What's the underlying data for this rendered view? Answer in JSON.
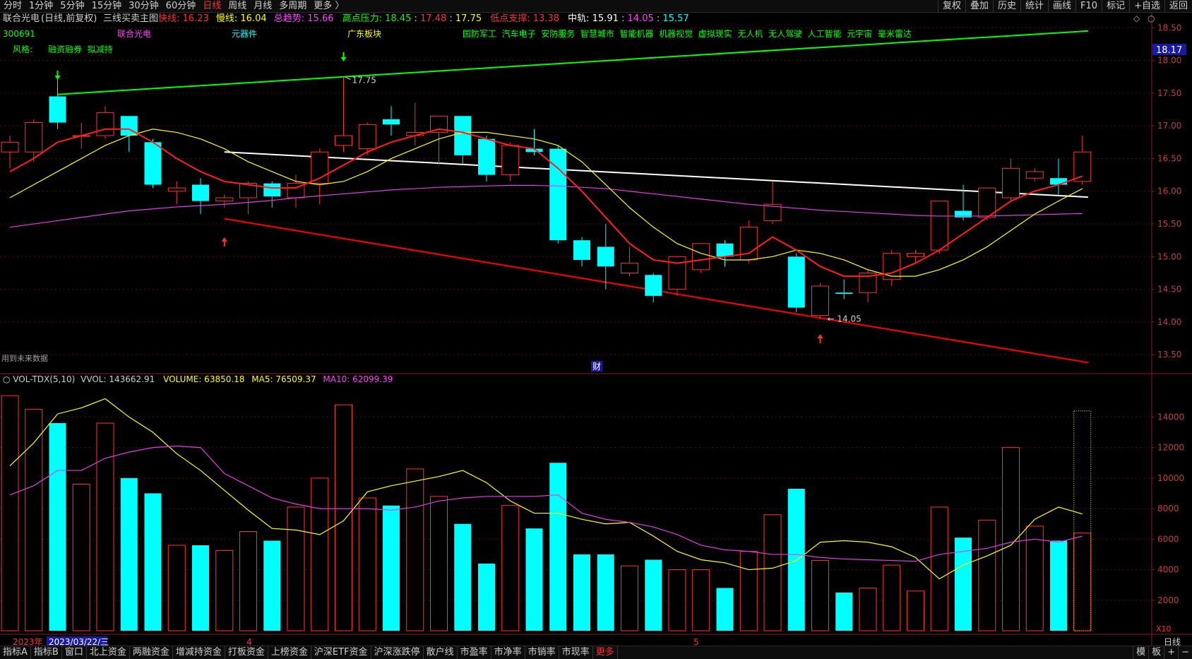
{
  "toolbar": {
    "left": [
      "分时",
      "1分钟",
      "5分钟",
      "15分钟",
      "30分钟",
      "60分钟",
      "日线",
      "周线",
      "月线",
      "多周期",
      "更多 〉"
    ],
    "active": "日线",
    "right": [
      "复权",
      "叠加",
      "历史",
      "统计",
      "画线",
      "F10",
      "标记",
      "+自选",
      "返回"
    ]
  },
  "header": {
    "stock": "联合光电",
    "mode": "(日线,前复权)",
    "indicator": "三线买卖主图",
    "items": [
      {
        "label": "快线: ",
        "value": "16.23",
        "color": "#ff3030"
      },
      {
        "label": "慢线: ",
        "value": "16.04",
        "color": "#ffff00"
      },
      {
        "label": "总趋势: ",
        "value": "15.66",
        "color": "#ff40ff"
      }
    ],
    "pressure_label": "高点压力: ",
    "pressure_values": [
      {
        "value": "18.45",
        "color": "#00ff00"
      },
      {
        "value": "17.48",
        "color": "#ff3030"
      },
      {
        "value": "17.75",
        "color": "#ffff00"
      }
    ],
    "support_label": "低点支撑: ",
    "support_value": "13.38",
    "mid_label": "中轨: ",
    "mid_value": "15.91",
    "mid_extra": [
      {
        "value": "14.05",
        "color": "#ff40ff"
      },
      {
        "value": "15.57",
        "color": "#00ffff"
      }
    ]
  },
  "info": {
    "code": "300691",
    "name": "联合光电",
    "sector1": "元器件",
    "sector2": "广东板块",
    "concepts": "国防军工  汽车电子  安防服务  智慧城市  智能机器  机器视觉  虚拟现实  无人机  无人驾驶  人工智能  元宇宙  毫米雷达",
    "style_label": "风格:",
    "style_value": "融资融券  拟减持",
    "future_note": "用到未来数据",
    "cai": "财"
  },
  "vol_header": {
    "name": "VOL-TDX(5,10)",
    "vvol": "VVOL: 143662.91",
    "volume": "VOLUME: 63850.18",
    "ma5": "MA5: 76509.37",
    "ma10": "MA10: 62099.39"
  },
  "xaxis": {
    "year": "2023年",
    "date": "2023/03/22/三",
    "m4": "4",
    "m5": "5",
    "scale": "X10",
    "rightlabel": "日线"
  },
  "bottombar": {
    "items": [
      "指标A",
      "指标B",
      "窗口",
      "北上资金",
      "两融资金",
      "增减持资金",
      "打板资金",
      "上榜资金",
      "沪深ETF资金",
      "沪深涨跌停",
      "散户线",
      "市盈率",
      "市净率",
      "市销率",
      "市现率",
      "更多"
    ],
    "red": "更多",
    "right": [
      "模",
      "板",
      "+",
      "−"
    ]
  },
  "chart_data": {
    "type": "candlestick",
    "price_ylim": [
      13.2,
      18.6
    ],
    "price_ticks": [
      "18.50",
      "18.00",
      "17.50",
      "17.00",
      "16.50",
      "16.00",
      "15.50",
      "15.00",
      "14.50",
      "14.00",
      "13.50"
    ],
    "current_price": "18.17",
    "candles": [
      {
        "o": 16.6,
        "c": 16.75,
        "h": 16.85,
        "l": 16.35
      },
      {
        "o": 16.6,
        "c": 17.05,
        "h": 17.1,
        "l": 16.45
      },
      {
        "o": 17.45,
        "c": 17.05,
        "h": 17.75,
        "l": 16.95
      },
      {
        "o": 16.85,
        "c": 16.85,
        "h": 17.05,
        "l": 16.65
      },
      {
        "o": 16.85,
        "c": 17.2,
        "h": 17.3,
        "l": 16.8
      },
      {
        "o": 17.15,
        "c": 16.85,
        "h": 17.15,
        "l": 16.6
      },
      {
        "o": 16.75,
        "c": 16.1,
        "h": 16.8,
        "l": 16.05
      },
      {
        "o": 16.0,
        "c": 16.05,
        "h": 16.15,
        "l": 15.8
      },
      {
        "o": 16.1,
        "c": 15.85,
        "h": 16.2,
        "l": 15.65
      },
      {
        "o": 15.85,
        "c": 15.9,
        "h": 15.95,
        "l": 15.75
      },
      {
        "o": 15.9,
        "c": 16.12,
        "h": 16.15,
        "l": 15.65
      },
      {
        "o": 16.12,
        "c": 15.92,
        "h": 16.15,
        "l": 15.75
      },
      {
        "o": 15.9,
        "c": 16.12,
        "h": 16.25,
        "l": 15.75
      },
      {
        "o": 16.12,
        "c": 16.6,
        "h": 16.65,
        "l": 15.8
      },
      {
        "o": 16.7,
        "c": 16.85,
        "h": 17.75,
        "l": 16.6
      },
      {
        "o": 16.65,
        "c": 17.02,
        "h": 17.05,
        "l": 16.55
      },
      {
        "o": 17.1,
        "c": 17.02,
        "h": 17.3,
        "l": 16.85
      },
      {
        "o": 16.85,
        "c": 16.9,
        "h": 17.35,
        "l": 16.7
      },
      {
        "o": 16.9,
        "c": 17.15,
        "h": 17.15,
        "l": 16.4
      },
      {
        "o": 17.15,
        "c": 16.55,
        "h": 17.15,
        "l": 16.4
      },
      {
        "o": 16.8,
        "c": 16.25,
        "h": 16.85,
        "l": 16.15
      },
      {
        "o": 16.25,
        "c": 16.7,
        "h": 16.75,
        "l": 16.15
      },
      {
        "o": 16.65,
        "c": 16.6,
        "h": 16.95,
        "l": 16.55
      },
      {
        "o": 16.65,
        "c": 15.25,
        "h": 16.7,
        "l": 15.2
      },
      {
        "o": 15.25,
        "c": 14.95,
        "h": 15.3,
        "l": 14.85
      },
      {
        "o": 15.15,
        "c": 14.85,
        "h": 15.5,
        "l": 14.5
      },
      {
        "o": 14.75,
        "c": 14.9,
        "h": 15.15,
        "l": 14.7
      },
      {
        "o": 14.72,
        "c": 14.4,
        "h": 14.75,
        "l": 14.3
      },
      {
        "o": 14.5,
        "c": 15.0,
        "h": 15.0,
        "l": 14.4
      },
      {
        "o": 14.8,
        "c": 15.2,
        "h": 15.2,
        "l": 14.75
      },
      {
        "o": 15.2,
        "c": 15.0,
        "h": 15.25,
        "l": 14.85
      },
      {
        "o": 14.95,
        "c": 15.45,
        "h": 15.55,
        "l": 14.9
      },
      {
        "o": 15.55,
        "c": 15.8,
        "h": 16.15,
        "l": 15.5
      },
      {
        "o": 15.0,
        "c": 14.22,
        "h": 15.05,
        "l": 14.15
      },
      {
        "o": 14.1,
        "c": 14.55,
        "h": 14.6,
        "l": 14.05
      },
      {
        "o": 14.45,
        "c": 14.43,
        "h": 14.65,
        "l": 14.35
      },
      {
        "o": 14.45,
        "c": 14.75,
        "h": 14.8,
        "l": 14.3
      },
      {
        "o": 14.65,
        "c": 15.05,
        "h": 15.1,
        "l": 14.55
      },
      {
        "o": 15.0,
        "c": 15.05,
        "h": 15.1,
        "l": 14.9
      },
      {
        "o": 15.1,
        "c": 15.85,
        "h": 15.85,
        "l": 15.05
      },
      {
        "o": 15.7,
        "c": 15.6,
        "h": 16.1,
        "l": 15.55
      },
      {
        "o": 15.6,
        "c": 16.05,
        "h": 16.05,
        "l": 15.55
      },
      {
        "o": 15.9,
        "c": 16.35,
        "h": 16.5,
        "l": 15.85
      },
      {
        "o": 16.2,
        "c": 16.3,
        "h": 16.35,
        "l": 16.15
      },
      {
        "o": 16.2,
        "c": 16.1,
        "h": 16.5,
        "l": 15.95
      },
      {
        "o": 16.15,
        "c": 16.6,
        "h": 16.85,
        "l": 16.1
      }
    ],
    "fast_line": [
      16.3,
      16.5,
      16.75,
      16.85,
      16.95,
      16.95,
      16.75,
      16.5,
      16.3,
      16.15,
      16.1,
      16.05,
      16.05,
      16.2,
      16.4,
      16.6,
      16.75,
      16.85,
      16.95,
      16.9,
      16.8,
      16.7,
      16.65,
      16.35,
      16.0,
      15.6,
      15.2,
      14.95,
      14.9,
      14.95,
      15.0,
      15.05,
      15.3,
      15.1,
      14.85,
      14.7,
      14.7,
      14.75,
      14.9,
      15.1,
      15.35,
      15.6,
      15.85,
      16.0,
      16.1,
      16.23
    ],
    "slow_line": [
      15.9,
      16.1,
      16.3,
      16.5,
      16.7,
      16.85,
      16.95,
      16.9,
      16.8,
      16.65,
      16.45,
      16.3,
      16.15,
      16.1,
      16.15,
      16.3,
      16.5,
      16.65,
      16.8,
      16.9,
      16.9,
      16.85,
      16.8,
      16.7,
      16.45,
      16.1,
      15.75,
      15.45,
      15.2,
      15.05,
      14.95,
      14.95,
      15.0,
      15.1,
      15.05,
      14.95,
      14.8,
      14.7,
      14.7,
      14.8,
      14.95,
      15.15,
      15.4,
      15.65,
      15.85,
      16.04
    ],
    "trend_line": [
      15.45,
      15.5,
      15.55,
      15.6,
      15.65,
      15.7,
      15.73,
      15.76,
      15.78,
      15.8,
      15.83,
      15.86,
      15.9,
      15.93,
      15.96,
      15.99,
      16.02,
      16.04,
      16.06,
      16.07,
      16.08,
      16.09,
      16.09,
      16.08,
      16.06,
      16.04,
      16.0,
      15.96,
      15.92,
      15.88,
      15.84,
      15.8,
      15.77,
      15.74,
      15.71,
      15.69,
      15.67,
      15.65,
      15.63,
      15.62,
      15.62,
      15.62,
      15.63,
      15.64,
      15.65,
      15.66
    ],
    "resistance": {
      "from": [
        2,
        17.48
      ],
      "to": [
        45,
        18.45
      ],
      "color": "#00ff00"
    },
    "support": {
      "from": [
        9,
        15.58
      ],
      "to": [
        45,
        13.38
      ],
      "color": "#ff0000"
    },
    "midline": {
      "from": [
        9,
        16.6
      ],
      "to": [
        45,
        15.91
      ],
      "color": "#ffffff"
    },
    "high_label": "17.75",
    "low_label": "14.05",
    "high_idx": 14,
    "low_idx": 34,
    "vol_ylim": [
      0,
      15500
    ],
    "vol_ticks": [
      "14000",
      "12000",
      "10000",
      "8000",
      "6000",
      "4000",
      "2000"
    ],
    "volumes": [
      15400,
      14500,
      13600,
      9600,
      13600,
      10000,
      9000,
      5600,
      5600,
      5250,
      6500,
      5900,
      8100,
      10000,
      14800,
      8700,
      8200,
      10600,
      8800,
      7000,
      4400,
      8200,
      6700,
      11000,
      5000,
      5000,
      4250,
      4650,
      4000,
      4000,
      2800,
      5200,
      7600,
      9300,
      4600,
      2500,
      2800,
      4300,
      2600,
      8100,
      6100,
      7250,
      12000,
      6850,
      5900,
      6400
    ],
    "vol_ma5": [
      10800,
      12300,
      14200,
      14600,
      15200,
      14000,
      13000,
      11600,
      10500,
      9200,
      7900,
      6700,
      6600,
      6300,
      7200,
      9100,
      9500,
      9800,
      10100,
      10500,
      9700,
      8500,
      7700,
      7700,
      7300,
      7000,
      7100,
      6200,
      5200,
      4650,
      4450,
      4000,
      4100,
      4600,
      5800,
      5900,
      5800,
      5500,
      4800,
      3400,
      4300,
      4900,
      5600,
      7300,
      8100,
      7650
    ],
    "vol_ma10": [
      8900,
      9500,
      10500,
      10500,
      11300,
      11700,
      12000,
      12100,
      12000,
      10300,
      9500,
      8700,
      8300,
      8000,
      8000,
      8000,
      7900,
      8100,
      8500,
      8700,
      8800,
      8800,
      8800,
      8900,
      7700,
      7300,
      7100,
      6800,
      6300,
      5600,
      5300,
      5200,
      5000,
      5000,
      4800,
      4700,
      4650,
      4600,
      4550,
      5000,
      5200,
      5400,
      5800,
      6000,
      5800,
      6200
    ]
  }
}
